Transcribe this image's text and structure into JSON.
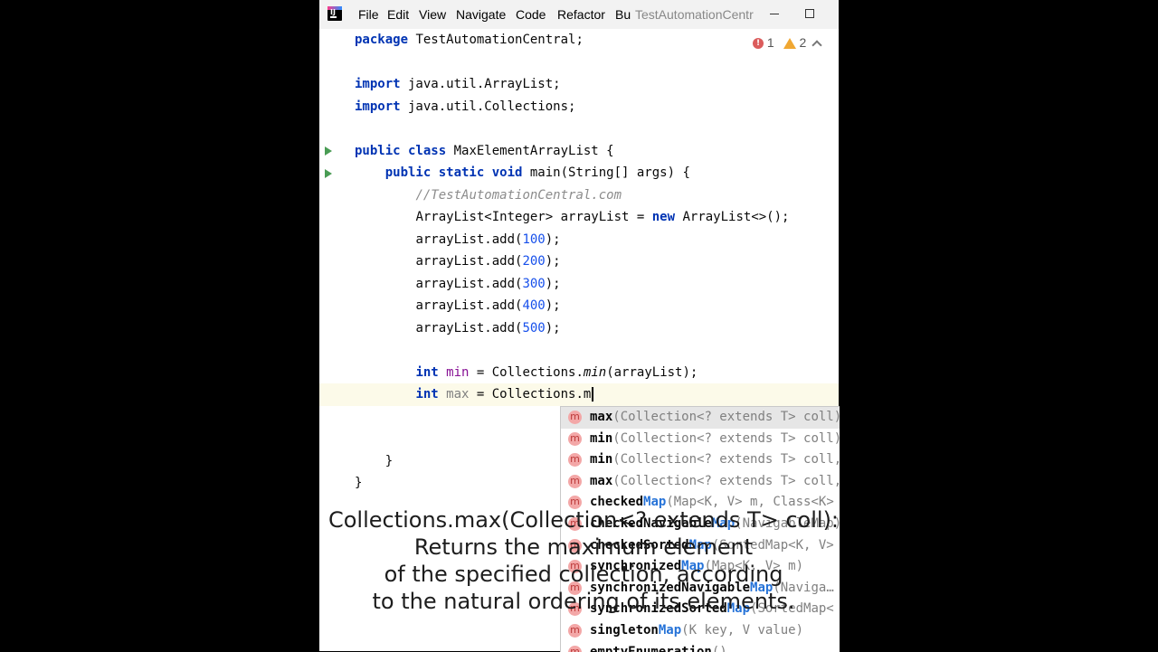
{
  "menu": {
    "file": "File",
    "edit": "Edit",
    "view": "View",
    "navigate": "Navigate",
    "code": "Code",
    "refactor": "Refactor",
    "build_partial": "Bu"
  },
  "window_title": "TestAutomationCentr",
  "inspection": {
    "errors": "1",
    "warnings": "2"
  },
  "code": {
    "l1_kw": "package",
    "l1_rest": " TestAutomationCentral;",
    "l3_kw": "import",
    "l3_rest": " java.util.ArrayList;",
    "l4_kw": "import",
    "l4_rest": " java.util.Collections;",
    "l6_kw": "public class",
    "l6_rest": " MaxElementArrayList {",
    "l7_kw": "public static void",
    "l7_rest": " main(String[] args) {",
    "l8_comment": "//TestAutomationCentral.com",
    "l9_a": "ArrayList<Integer> arrayList = ",
    "l9_kw": "new",
    "l9_b": " ArrayList<>();",
    "adds": [
      {
        "pre": "arrayList.add(",
        "num": "100",
        "post": ");"
      },
      {
        "pre": "arrayList.add(",
        "num": "200",
        "post": ");"
      },
      {
        "pre": "arrayList.add(",
        "num": "300",
        "post": ");"
      },
      {
        "pre": "arrayList.add(",
        "num": "400",
        "post": ");"
      },
      {
        "pre": "arrayList.add(",
        "num": "500",
        "post": ");"
      }
    ],
    "min_kw": "int",
    "min_var": " min",
    "min_a": " = Collections.",
    "min_fn": "min",
    "min_b": "(arrayList);",
    "max_kw": "int",
    "max_var": " max",
    "max_a": " = Collections.m",
    "close_inner": "}",
    "close_outer": "}"
  },
  "suggestions": [
    {
      "name": "max",
      "sig": "(Collection<? extends T> coll)"
    },
    {
      "name": "min",
      "sig": "(Collection<? extends T> coll)"
    },
    {
      "name": "min",
      "sig": "(Collection<? extends T> coll, Comparator)"
    },
    {
      "name": "max",
      "sig": "(Collection<? extends T> coll, Comparator)"
    },
    {
      "pre": "checked",
      "hit": "Map",
      "sig": "(Map<K, V> m, Class<K> keyType)"
    },
    {
      "pre": "checkedNavigable",
      "hit": "Map",
      "sig": "(NavigableMap)"
    },
    {
      "pre": "checkedSorted",
      "hit": "Map",
      "sig": "(SortedMap<K, V> m)"
    },
    {
      "pre": "synchronized",
      "hit": "Map",
      "sig": "(Map<K, V> m)"
    },
    {
      "pre": "synchronizedNavigable",
      "hit": "Map",
      "sig": "(Naviga…"
    },
    {
      "pre": "synchronizedSorted",
      "hit": "Map",
      "sig": "(SortedMap<"
    },
    {
      "pre": "singleton",
      "hit": "Map",
      "sig": "(K key, V value)"
    },
    {
      "pre": "emptyEnumeration",
      "hit": "",
      "sig": "()"
    }
  ],
  "caption": [
    "Collections.max(Collection<? extends T> coll):",
    "Returns the maximum element",
    "of the specified collection, according",
    "to the natural ordering of its elements."
  ]
}
